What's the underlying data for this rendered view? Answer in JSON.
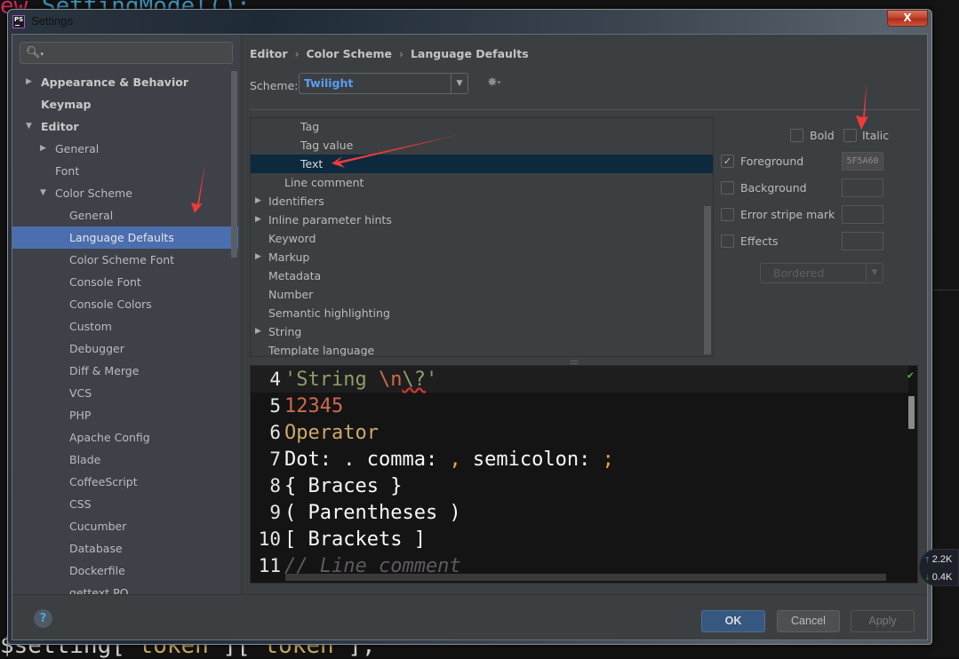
{
  "background": {
    "top_code": "SettingModel();",
    "top_keyword": "ew",
    "bottom_code_prefix": "$setting[",
    "bottom_str1": "'token'",
    "bottom_mid": "][",
    "bottom_str2": "'token'",
    "bottom_suffix": "];"
  },
  "window": {
    "title": "Settings",
    "app_icon": "PS",
    "close_label": "X"
  },
  "sidebar": {
    "search_placeholder": "",
    "items": [
      {
        "label": "Appearance & Behavior",
        "level": 0,
        "bold": true,
        "arrow": "right"
      },
      {
        "label": "Keymap",
        "level": 0,
        "bold": true,
        "arrow": ""
      },
      {
        "label": "Editor",
        "level": 0,
        "bold": true,
        "arrow": "down"
      },
      {
        "label": "General",
        "level": 1,
        "bold": false,
        "arrow": "right"
      },
      {
        "label": "Font",
        "level": 1,
        "bold": false,
        "arrow": ""
      },
      {
        "label": "Color Scheme",
        "level": 1,
        "bold": false,
        "arrow": "down"
      },
      {
        "label": "General",
        "level": 2,
        "bold": false,
        "arrow": ""
      },
      {
        "label": "Language Defaults",
        "level": 2,
        "bold": false,
        "arrow": "",
        "selected": true
      },
      {
        "label": "Color Scheme Font",
        "level": 2,
        "bold": false,
        "arrow": ""
      },
      {
        "label": "Console Font",
        "level": 2,
        "bold": false,
        "arrow": ""
      },
      {
        "label": "Console Colors",
        "level": 2,
        "bold": false,
        "arrow": ""
      },
      {
        "label": "Custom",
        "level": 2,
        "bold": false,
        "arrow": ""
      },
      {
        "label": "Debugger",
        "level": 2,
        "bold": false,
        "arrow": ""
      },
      {
        "label": "Diff & Merge",
        "level": 2,
        "bold": false,
        "arrow": ""
      },
      {
        "label": "VCS",
        "level": 2,
        "bold": false,
        "arrow": ""
      },
      {
        "label": "PHP",
        "level": 2,
        "bold": false,
        "arrow": ""
      },
      {
        "label": "Apache Config",
        "level": 2,
        "bold": false,
        "arrow": ""
      },
      {
        "label": "Blade",
        "level": 2,
        "bold": false,
        "arrow": ""
      },
      {
        "label": "CoffeeScript",
        "level": 2,
        "bold": false,
        "arrow": ""
      },
      {
        "label": "CSS",
        "level": 2,
        "bold": false,
        "arrow": ""
      },
      {
        "label": "Cucumber",
        "level": 2,
        "bold": false,
        "arrow": ""
      },
      {
        "label": "Database",
        "level": 2,
        "bold": false,
        "arrow": ""
      },
      {
        "label": "Dockerfile",
        "level": 2,
        "bold": false,
        "arrow": ""
      },
      {
        "label": "gettext PO",
        "level": 2,
        "bold": false,
        "arrow": ""
      }
    ]
  },
  "breadcrumb": [
    "Editor",
    "Color Scheme",
    "Language Defaults"
  ],
  "breadcrumb_separator": "›",
  "scheme": {
    "label": "Scheme:",
    "value": "Twilight"
  },
  "attributes_tree": [
    {
      "label": "Tag",
      "indent": 2,
      "arrow": false
    },
    {
      "label": "Tag value",
      "indent": 2,
      "arrow": false
    },
    {
      "label": "Text",
      "indent": 2,
      "arrow": false,
      "selected": true
    },
    {
      "label": "Line comment",
      "indent": 1,
      "arrow": false
    },
    {
      "label": "Identifiers",
      "indent": 0,
      "arrow": true
    },
    {
      "label": "Inline parameter hints",
      "indent": 0,
      "arrow": true
    },
    {
      "label": "Keyword",
      "indent": 0,
      "arrow": false
    },
    {
      "label": "Markup",
      "indent": 0,
      "arrow": true
    },
    {
      "label": "Metadata",
      "indent": 0,
      "arrow": false
    },
    {
      "label": "Number",
      "indent": 0,
      "arrow": false
    },
    {
      "label": "Semantic highlighting",
      "indent": 0,
      "arrow": false
    },
    {
      "label": "String",
      "indent": 0,
      "arrow": true
    },
    {
      "label": "Template language",
      "indent": 0,
      "arrow": false
    }
  ],
  "attributes": {
    "bold": {
      "label": "Bold",
      "checked": false
    },
    "italic": {
      "label": "Italic",
      "checked": false
    },
    "foreground": {
      "label": "Foreground",
      "checked": true,
      "value": "5F5A60"
    },
    "background": {
      "label": "Background",
      "checked": false,
      "value": ""
    },
    "error_stripe": {
      "label": "Error stripe mark",
      "checked": false,
      "value": ""
    },
    "effects": {
      "label": "Effects",
      "checked": false,
      "value": ""
    },
    "effect_type": "Bordered"
  },
  "preview": {
    "lines": [
      {
        "n": "4",
        "segments": [
          {
            "t": "'String ",
            "c": "c-string"
          },
          {
            "t": "\\n",
            "c": "c-escape"
          },
          {
            "t": "\\?",
            "c": "c-bad"
          },
          {
            "t": "'",
            "c": "c-string"
          }
        ],
        "current": true
      },
      {
        "n": "5",
        "segments": [
          {
            "t": "12345",
            "c": "c-number"
          }
        ]
      },
      {
        "n": "6",
        "segments": [
          {
            "t": "Operator",
            "c": "c-operator"
          }
        ]
      },
      {
        "n": "7",
        "segments": [
          {
            "t": "Dot: . comma: ",
            "c": ""
          },
          {
            "t": ",",
            "c": "c-punct"
          },
          {
            "t": " semicolon: ",
            "c": ""
          },
          {
            "t": ";",
            "c": "c-punct"
          }
        ]
      },
      {
        "n": "8",
        "segments": [
          {
            "t": "{ Braces }",
            "c": ""
          }
        ]
      },
      {
        "n": "9",
        "segments": [
          {
            "t": "( Parentheses )",
            "c": ""
          }
        ]
      },
      {
        "n": "10",
        "segments": [
          {
            "t": "[ Brackets ]",
            "c": ""
          }
        ]
      },
      {
        "n": "11",
        "segments": [
          {
            "t": "// Line comment",
            "c": "c-comment"
          }
        ]
      }
    ]
  },
  "buttons": {
    "help": "?",
    "ok": "OK",
    "cancel": "Cancel",
    "apply": "Apply"
  },
  "network": {
    "upload": "2.2K",
    "download": "0.4K"
  },
  "colors": {
    "selection": "#4b6eaf",
    "scheme_value": "#589df6",
    "foreground_value": "#5F5A60",
    "ok_button": "#365880",
    "annotation_arrow": "#f03a3a"
  }
}
